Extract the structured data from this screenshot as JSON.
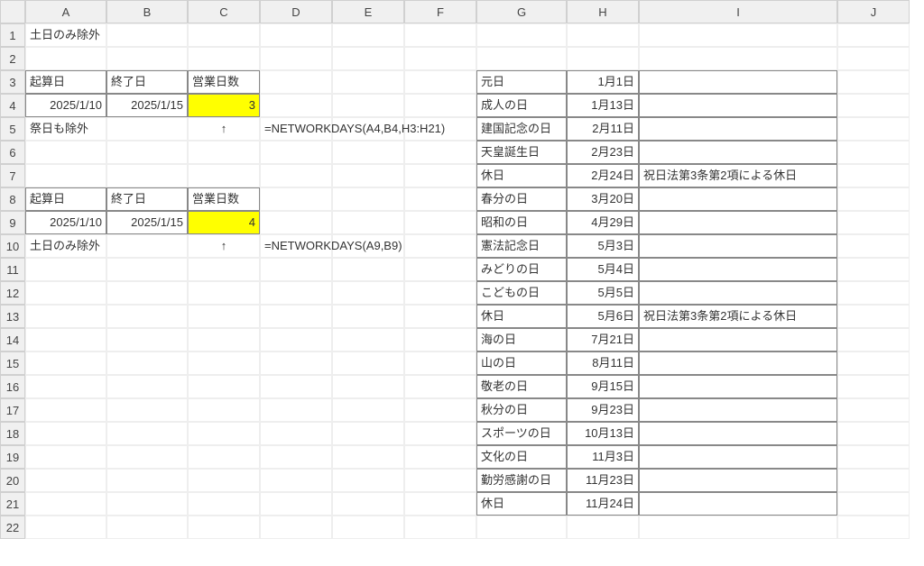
{
  "columns": [
    "A",
    "B",
    "C",
    "D",
    "E",
    "F",
    "G",
    "H",
    "I",
    "J"
  ],
  "rowCount": 22,
  "cells": {
    "A1": "土日のみ除外",
    "A3": "起算日",
    "B3": "終了日",
    "C3": "営業日数",
    "A4": "2025/1/10",
    "B4": "2025/1/15",
    "C4": "3",
    "A5": "祭日も除外",
    "C5": "↑",
    "D5": "=NETWORKDAYS(A4,B4,H3:H21)",
    "A8": "起算日",
    "B8": "終了日",
    "C8": "営業日数",
    "A9": "2025/1/10",
    "B9": "2025/1/15",
    "C9": "4",
    "A10": "土日のみ除外",
    "C10": "↑",
    "D10": "=NETWORKDAYS(A9,B9)",
    "G3": "元日",
    "H3": "1月1日",
    "G4": "成人の日",
    "H4": "1月13日",
    "G5": "建国記念の日",
    "H5": "2月11日",
    "G6": "天皇誕生日",
    "H6": "2月23日",
    "G7": "休日",
    "H7": "2月24日",
    "I7": "祝日法第3条第2項による休日",
    "G8": "春分の日",
    "H8": "3月20日",
    "G9": "昭和の日",
    "H9": "4月29日",
    "G10": "憲法記念日",
    "H10": "5月3日",
    "G11": "みどりの日",
    "H11": "5月4日",
    "G12": "こどもの日",
    "H12": "5月5日",
    "G13": "休日",
    "H13": "5月6日",
    "I13": "祝日法第3条第2項による休日",
    "G14": "海の日",
    "H14": "7月21日",
    "G15": "山の日",
    "H15": "8月11日",
    "G16": "敬老の日",
    "H16": "9月15日",
    "G17": "秋分の日",
    "H17": "9月23日",
    "G18": "スポーツの日",
    "H18": "10月13日",
    "G19": "文化の日",
    "H19": "11月3日",
    "G20": "勤労感謝の日",
    "H20": "11月23日",
    "G21": "休日",
    "H21": "11月24日"
  },
  "style": {
    "highlight_color": "#ffff00",
    "grid_color": "#d0d0d0",
    "border_color": "#888"
  }
}
